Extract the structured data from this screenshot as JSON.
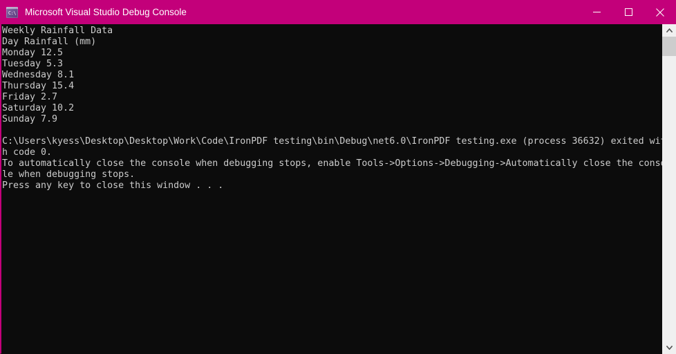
{
  "window": {
    "title": "Microsoft Visual Studio Debug Console",
    "icon": "console-app-icon",
    "icon_glyph": "C:\\",
    "titlebar_color": "#c3007a",
    "background_color": "#0c0c0c",
    "text_color": "#cccccc",
    "border_color": "#c3007a"
  },
  "window_controls": {
    "minimize_label": "Minimize",
    "maximize_label": "Maximize",
    "close_label": "Close"
  },
  "console": {
    "output": "Weekly Rainfall Data\nDay Rainfall (mm)\nMonday 12.5\nTuesday 5.3\nWednesday 8.1\nThursday 15.4\nFriday 2.7\nSaturday 10.2\nSunday 7.9\n\nC:\\Users\\kyess\\Desktop\\Desktop\\Work\\Code\\IronPDF testing\\bin\\Debug\\net6.0\\IronPDF testing.exe (process 36632) exited wit\nh code 0.\nTo automatically close the console when debugging stops, enable Tools->Options->Debugging->Automatically close the conso\nle when debugging stops.\nPress any key to close this window . . .",
    "report_title": "Weekly Rainfall Data",
    "table_header": "Day Rainfall (mm)",
    "rows": [
      {
        "day": "Monday",
        "rainfall_mm": 12.5
      },
      {
        "day": "Tuesday",
        "rainfall_mm": 5.3
      },
      {
        "day": "Wednesday",
        "rainfall_mm": 8.1
      },
      {
        "day": "Thursday",
        "rainfall_mm": 15.4
      },
      {
        "day": "Friday",
        "rainfall_mm": 2.7
      },
      {
        "day": "Saturday",
        "rainfall_mm": 10.2
      },
      {
        "day": "Sunday",
        "rainfall_mm": 7.9
      }
    ],
    "exit_line": "C:\\Users\\kyess\\Desktop\\Desktop\\Work\\Code\\IronPDF testing\\bin\\Debug\\net6.0\\IronPDF testing.exe (process 36632) exited with code 0.",
    "executable_path": "C:\\Users\\kyess\\Desktop\\Desktop\\Work\\Code\\IronPDF testing\\bin\\Debug\\net6.0\\IronPDF testing.exe",
    "process_id": "36632",
    "exit_code": "0",
    "hint_line": "To automatically close the console when debugging stops, enable Tools->Options->Debugging->Automatically close the console when debugging stops.",
    "prompt_line": "Press any key to close this window . . ."
  },
  "scrollbar": {
    "up_arrow": "chevron-up-icon",
    "down_arrow": "chevron-down-icon",
    "thumb_label": "scroll-thumb"
  }
}
